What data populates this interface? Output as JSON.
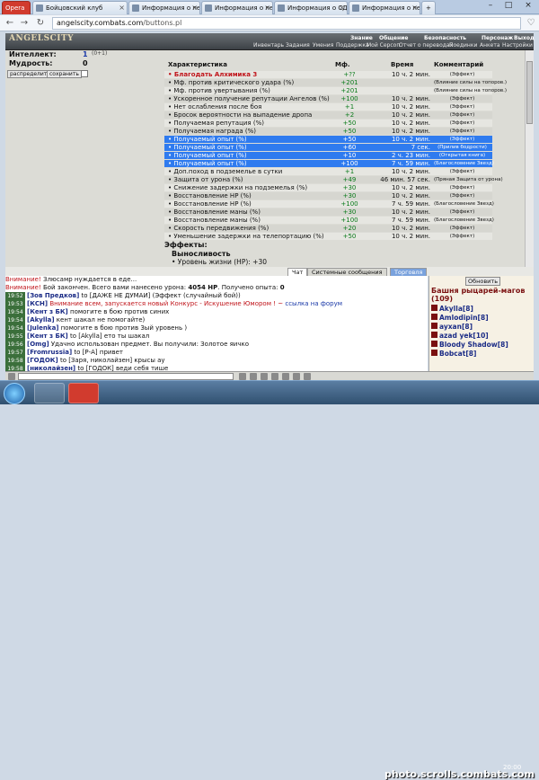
{
  "browser": {
    "opera_tab": "Opera",
    "tabs": [
      "Бойцовский клуб",
      "Информация о пе",
      "Информация о пе",
      "Информация о СД",
      "Информация о пе"
    ],
    "url_domain": "angelscity.combats.com",
    "url_path": "/buttons.pl"
  },
  "game_menu": {
    "logo": "ANGELSCITY",
    "top_items": [
      "Знание",
      "Общение",
      "Безопасность",
      "Персонаж",
      "Выход"
    ],
    "sub_items": [
      "Инвентарь",
      "Задания",
      "Умения",
      "Поддержка",
      "Мой Серсоп",
      "Отчет о переводах",
      "Поединки",
      "Анкета",
      "Настройки"
    ]
  },
  "left": {
    "stats": [
      {
        "label": "Интеллект:",
        "value": "1",
        "bonus": "(0+1)"
      },
      {
        "label": "Мудрость:",
        "value": "0"
      }
    ],
    "buttons": [
      "распределить",
      "сохранить"
    ]
  },
  "table": {
    "headers": {
      "name": "Характеристика",
      "mf": "Мф.",
      "time": "Время",
      "comment": "Комментарий"
    },
    "rows": [
      {
        "name": "• Благодать Алхимика 3",
        "mf": "+??",
        "time": "10 ч. 2 мин.",
        "comment": "(Эффект)",
        "special": "red"
      },
      {
        "name": "• Мф. против критического удара (%)",
        "mf": "+201",
        "time": "",
        "comment": "(Влияние силы на топоров.)"
      },
      {
        "name": "• Мф. против увертывания (%)",
        "mf": "+201",
        "time": "",
        "comment": "(Влияние силы на топоров.)"
      },
      {
        "name": "• Ускоренное получение репутации Ангелов (%)",
        "mf": "+100",
        "time": "10 ч. 2 мин.",
        "comment": "(Эффект)"
      },
      {
        "name": "• Нет ослабления после боя",
        "mf": "+1",
        "time": "10 ч. 2 мин.",
        "comment": "(Эффект)"
      },
      {
        "name": "• Бросок вероятности на выпадение дропа",
        "mf": "+2",
        "time": "10 ч. 2 мин.",
        "comment": "(Эффект)"
      },
      {
        "name": "• Получаемая репутация (%)",
        "mf": "+50",
        "time": "10 ч. 2 мин.",
        "comment": "(Эффект)"
      },
      {
        "name": "• Получаемая награда (%)",
        "mf": "+50",
        "time": "10 ч. 2 мин.",
        "comment": "(Эффект)"
      },
      {
        "name": "• Получаемый опыт (%)",
        "mf": "+50",
        "time": "10 ч. 2 мин.",
        "comment": "(Эффект)",
        "special": "sel"
      },
      {
        "name": "• Получаемый опыт (%)",
        "mf": "+60",
        "time": "7 сек.",
        "comment": "(Прилив бодрости)",
        "special": "sel"
      },
      {
        "name": "• Получаемый опыт (%)",
        "mf": "+10",
        "time": "2 ч. 23 мин.",
        "comment": "(Открытая книга)",
        "special": "sel"
      },
      {
        "name": "• Получаемый опыт (%)",
        "mf": "+100",
        "time": "7 ч. 59 мин.",
        "comment": "(Благословение Звезд)",
        "special": "sel"
      },
      {
        "name": "• Доп.поход в подземелье в сутки",
        "mf": "+1",
        "time": "10 ч. 2 мин.",
        "comment": "(Эффект)"
      },
      {
        "name": "• Защита от урона (%)",
        "mf": "+49",
        "time": "46 мин. 57 сек.",
        "comment": "(Пряная Защита от урона)"
      },
      {
        "name": "• Снижение задержки на подземелья (%)",
        "mf": "+30",
        "time": "10 ч. 2 мин.",
        "comment": "(Эффект)"
      },
      {
        "name": "• Восстановление HP (%)",
        "mf": "+30",
        "time": "10 ч. 2 мин.",
        "comment": "(Эффект)"
      },
      {
        "name": "• Восстановление HP (%)",
        "mf": "+100",
        "time": "7 ч. 59 мин.",
        "comment": "(Благословение Звезд)"
      },
      {
        "name": "• Восстановление маны (%)",
        "mf": "+30",
        "time": "10 ч. 2 мин.",
        "comment": "(Эффект)"
      },
      {
        "name": "• Восстановление маны (%)",
        "mf": "+100",
        "time": "7 ч. 59 мин.",
        "comment": "(Благословение Звезд)"
      },
      {
        "name": "• Скорость передвижения (%)",
        "mf": "+20",
        "time": "10 ч. 2 мин.",
        "comment": "(Эффект)"
      },
      {
        "name": "• Уменьшение задержки на телепортацию (%)",
        "mf": "+50",
        "time": "10 ч. 2 мин.",
        "comment": "(Эффект)"
      }
    ],
    "effects_title": "Эффекты:",
    "effect_name": "Выносливость",
    "effect_line": "• Уровень жизни (HP): +30"
  },
  "chat_tabs": [
    "Чат",
    "Системные сообщения",
    "Торговля"
  ],
  "chat": [
    {
      "time": "",
      "html": "<span class='red'>Внимание!</span> Злюсамр нуждается в еде..."
    },
    {
      "time": "",
      "html": "<span class='red'>Внимание!</span> Бой закончен. Всего вами нанесено урона: <b>4054 HP</b>. Получено опыта: <b>0</b>"
    },
    {
      "time": "19:52",
      "html": "<span class='nick'>[Зов Предков]</span> to [ДАЖЕ НЕ ДУМАЙ] (Эффект (случайный бой))"
    },
    {
      "time": "19:53",
      "html": "<span class='nick'>[КСН]</span> <span class='red'>Внимание всем, запускается новый Конкурс - Искушение Юмором ! ~</span> <span class='blue'>ссылка на форум</span>"
    },
    {
      "time": "19:54",
      "html": "<span class='nick'>[Кент з БК]</span> помогите в бою против синих"
    },
    {
      "time": "19:54",
      "html": "<span class='nick'>[Akylla]</span> кент шакал не помогайте)"
    },
    {
      "time": "19:54",
      "html": "<span class='nick'>[Julenka]</span> помогите в бою против 3ый уровень )"
    },
    {
      "time": "19:55",
      "html": "<span class='nick'>[Кент з БК]</span> to [Akylla] ето ты шакал"
    },
    {
      "time": "19:56",
      "html": "<span class='nick'>[Omg]</span> Удачно использован предмет. Вы получили: Золотое яичко"
    },
    {
      "time": "19:57",
      "html": "<span class='nick'>[Fromrussia]</span> to [Р-А] привет"
    },
    {
      "time": "19:58",
      "html": "<span class='nick'>[ГОДОК]</span> to [Заря, николайзен] крысы ау"
    },
    {
      "time": "19:58",
      "html": "<span class='nick'>[николайзен]</span> to [ГОДОК] веди себя тише"
    }
  ],
  "right_panel": {
    "update": "Обновить",
    "room": "Башня рыцарей-магов",
    "count": "(109)",
    "users": [
      "Akylla[8]",
      "Amlodipin[8]",
      "ayxan[8]",
      "azad yek[10]",
      "Bloody Shadow[8]",
      "Bobcat[8]"
    ]
  },
  "taskbar": {
    "watermark": "photo.scrolls.combats.com",
    "time": "20:00"
  }
}
